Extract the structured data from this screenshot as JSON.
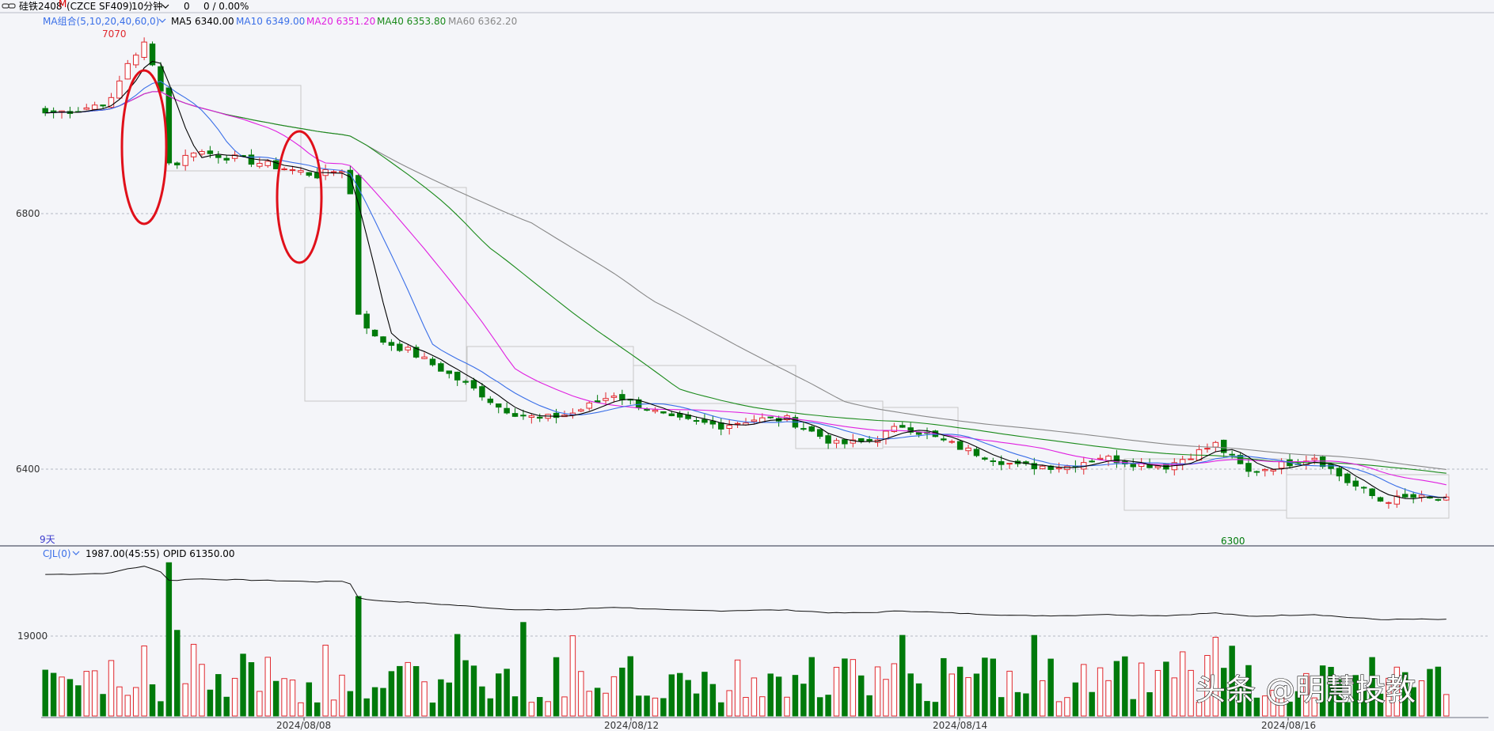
{
  "header": {
    "window_icon": "link-icon",
    "symbol": "硅铁2408",
    "symbol_suffix": "M",
    "exchange_code": "(CZCE SF409)",
    "period": "10分钟",
    "val1": "0",
    "val2": "0 / 0.00%"
  },
  "ma_legend": {
    "group_label": "MA组合(5,10,20,40,60,0)",
    "items": [
      {
        "text": "MA5 6340.00",
        "color": "#000000"
      },
      {
        "text": "MA10 6349.00",
        "color": "#3a6fe8"
      },
      {
        "text": "MA20 6351.20",
        "color": "#e020e0"
      },
      {
        "text": "MA40 6353.80",
        "color": "#1a8a1a"
      },
      {
        "text": "MA60 6362.20",
        "color": "#888888"
      }
    ]
  },
  "volume_legend": {
    "label": "CJL(0)",
    "vol": "1987.00(45:55)",
    "opid": "OPID 61350.00"
  },
  "annotations": {
    "high_label": "7070",
    "low_label": "6300",
    "days_label": "9天"
  },
  "price_axis": {
    "ticks": [
      "6800",
      "6400"
    ]
  },
  "volume_axis": {
    "ticks": [
      "19000"
    ]
  },
  "date_labels": [
    "2024/08/08",
    "2024/08/12",
    "2024/08/14",
    "2024/08/16"
  ],
  "watermark": "头条 @明慧投教",
  "colors": {
    "up": "#e0282e",
    "down": "#007a0b",
    "background": "#f4f5f9",
    "highlight": "#e0101a"
  },
  "chart_data": {
    "type": "candlestick",
    "title": "硅铁2408",
    "price_range": [
      6300,
      7070
    ],
    "volume_tick": 19000,
    "x": [
      "2024/08/08",
      "2024/08/12",
      "2024/08/14",
      "2024/08/16"
    ],
    "series": [
      {
        "name": "MA5",
        "last": 6340.0
      },
      {
        "name": "MA10",
        "last": 6349.0
      },
      {
        "name": "MA20",
        "last": 6351.2
      },
      {
        "name": "MA40",
        "last": 6353.8
      },
      {
        "name": "MA60",
        "last": 6362.2
      }
    ],
    "price_path": [
      [
        0,
        6960
      ],
      [
        4,
        6965
      ],
      [
        8,
        6980
      ],
      [
        10,
        7040
      ],
      [
        12,
        7070
      ],
      [
        14,
        7000
      ],
      [
        15,
        6880
      ],
      [
        16,
        6880
      ],
      [
        18,
        6900
      ],
      [
        22,
        6890
      ],
      [
        26,
        6880
      ],
      [
        33,
        6860
      ],
      [
        36,
        6870
      ],
      [
        37,
        6830
      ],
      [
        38,
        6640
      ],
      [
        40,
        6600
      ],
      [
        44,
        6580
      ],
      [
        48,
        6550
      ],
      [
        53,
        6510
      ],
      [
        55,
        6490
      ],
      [
        57,
        6480
      ],
      [
        60,
        6470
      ],
      [
        64,
        6480
      ],
      [
        69,
        6510
      ],
      [
        76,
        6470
      ],
      [
        82,
        6460
      ],
      [
        86,
        6470
      ],
      [
        90,
        6470
      ],
      [
        96,
        6430
      ],
      [
        100,
        6435
      ],
      [
        104,
        6460
      ],
      [
        108,
        6440
      ],
      [
        112,
        6420
      ],
      [
        118,
        6395
      ],
      [
        124,
        6395
      ],
      [
        128,
        6410
      ],
      [
        132,
        6400
      ],
      [
        136,
        6395
      ],
      [
        142,
        6430
      ],
      [
        146,
        6385
      ],
      [
        154,
        6410
      ],
      [
        158,
        6370
      ],
      [
        162,
        6340
      ],
      [
        166,
        6345
      ],
      [
        170,
        6340
      ]
    ]
  }
}
